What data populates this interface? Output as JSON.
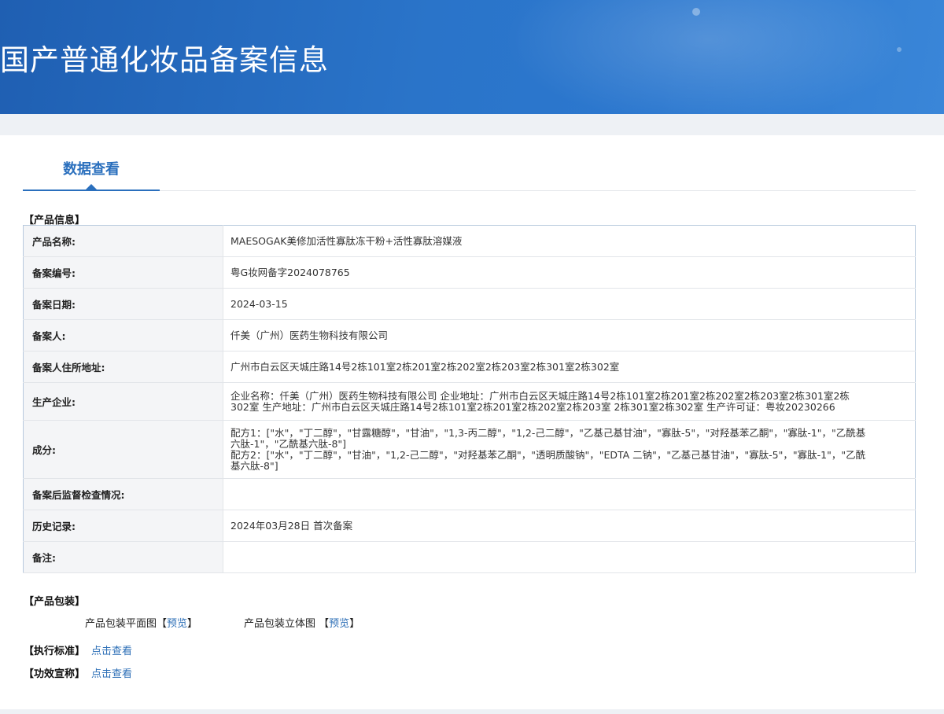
{
  "header": {
    "title": "国产普通化妆品备案信息"
  },
  "tabs": [
    {
      "label": "数据查看",
      "active": true
    }
  ],
  "product_info": {
    "section_title": "【产品信息】",
    "rows": [
      {
        "label": "产品名称:",
        "value": "MAESOGAK美修加活性寡肽冻干粉+活性寡肽溶媒液"
      },
      {
        "label": "备案编号:",
        "value": "粤G妆网备字2024078765"
      },
      {
        "label": "备案日期:",
        "value": "2024-03-15"
      },
      {
        "label": "备案人:",
        "value": "仟美（广州）医药生物科技有限公司"
      },
      {
        "label": "备案人住所地址:",
        "value": "广州市白云区天城庄路14号2栋101室2栋201室2栋202室2栋203室2栋301室2栋302室"
      },
      {
        "label": "生产企业:",
        "value": "企业名称：仟美（广州）医药生物科技有限公司 企业地址：广州市白云区天城庄路14号2栋101室2栋201室2栋202室2栋203室2栋301室2栋302室 生产地址：广州市白云区天城庄路14号2栋101室2栋201室2栋202室2栋203室 2栋301室2栋302室 生产许可证：粤妆20230266"
      },
      {
        "label": "成分:",
        "value_lines": [
          "配方1：[\"水\"，\"丁二醇\"，\"甘露糖醇\"，\"甘油\"，\"1,3-丙二醇\"，\"1,2-己二醇\"，\"乙基己基甘油\"，\"寡肽-5\"，\"对羟基苯乙酮\"，\"寡肽-1\"，\"乙酰基六肽-1\"，\"乙酰基六肽-8\"]",
          "配方2：[\"水\"，\"丁二醇\"，\"甘油\"，\"1,2-己二醇\"，\"对羟基苯乙酮\"，\"透明质酸钠\"，\"EDTA 二钠\"，\"乙基己基甘油\"，\"寡肽-5\"，\"寡肽-1\"，\"乙酰基六肽-8\"]"
        ]
      },
      {
        "label": "备案后监督检查情况:",
        "value": ""
      },
      {
        "label": "历史记录:",
        "value": "2024年03月28日 首次备案"
      },
      {
        "label": "备注:",
        "value": ""
      }
    ]
  },
  "packaging": {
    "section_title": "【产品包装】",
    "flat_label": "产品包装平面图",
    "stereo_label": "产品包装立体图",
    "bracket_open": "【",
    "bracket_close": "】",
    "preview_link": "预览"
  },
  "standard": {
    "label": "【执行标准】",
    "link": "点击查看"
  },
  "efficacy": {
    "label": "【功效宣称】",
    "link": "点击查看"
  },
  "colors": {
    "banner": "#2a74c9",
    "accent": "#2a6fbd",
    "link": "#2d6fb7"
  }
}
